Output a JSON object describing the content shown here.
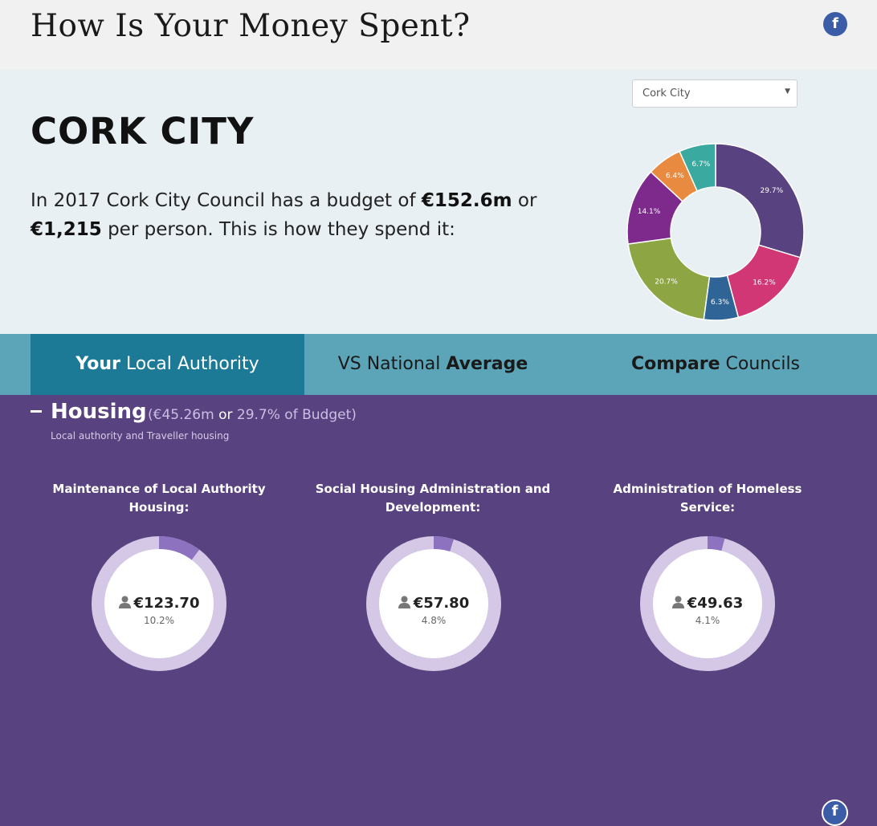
{
  "header": {
    "title": "How Is Your Money Spent?",
    "facebook_icon": "f"
  },
  "hero": {
    "select": {
      "value": "Cork City"
    },
    "council_name": "CORK CITY",
    "budget_text": {
      "p1": "In 2017 Cork City Council has a budget of ",
      "amount": "€152.6m",
      "p2": " or ",
      "per_person": "€1,215",
      "p3": " per person. This is how they spend it:"
    }
  },
  "chart_data": {
    "type": "pie",
    "categories": [
      "",
      "",
      "",
      "",
      "",
      "",
      ""
    ],
    "values": [
      29.7,
      16.2,
      6.3,
      20.7,
      14.1,
      6.4,
      6.7
    ],
    "labels": [
      "29.7%",
      "16.2%",
      "6.3%",
      "20.7%",
      "14.1%",
      "6.4%",
      "6.7%"
    ],
    "colors": [
      "#58427f",
      "#d13775",
      "#2e6496",
      "#8ea544",
      "#7d2a8c",
      "#e88a3f",
      "#3aa9a0"
    ],
    "donut": true
  },
  "tabs": [
    {
      "bold": "Your",
      "text": " Local Authority",
      "bold_first": true,
      "active": true
    },
    {
      "bold": "Average",
      "text": "VS National ",
      "bold_first": false,
      "active": false
    },
    {
      "bold": "Compare",
      "text": " Councils",
      "bold_first": true,
      "active": false
    }
  ],
  "section": {
    "title": "Housing",
    "amount": "(€45.26m",
    "or": "or",
    "percent": "29.7% of Budget)",
    "description": "Local authority and Traveller housing",
    "facebook_icon": "f",
    "cards": [
      {
        "title": "Maintenance of Local Authority Housing:",
        "value": "€123.70",
        "percent_label": "10.2%",
        "fraction": 0.102
      },
      {
        "title": "Social Housing Administration and Development:",
        "value": "€57.80",
        "percent_label": "4.8%",
        "fraction": 0.048
      },
      {
        "title": "Administration of Homeless Service:",
        "value": "€49.63",
        "percent_label": "4.1%",
        "fraction": 0.041
      }
    ]
  },
  "colors": {
    "ring_track": "#d4c8e6",
    "ring_fill": "#8d72c0",
    "section_bg": "#58427f",
    "tab_bar": "#5ca5b8",
    "tab_active": "#1c7a96"
  }
}
